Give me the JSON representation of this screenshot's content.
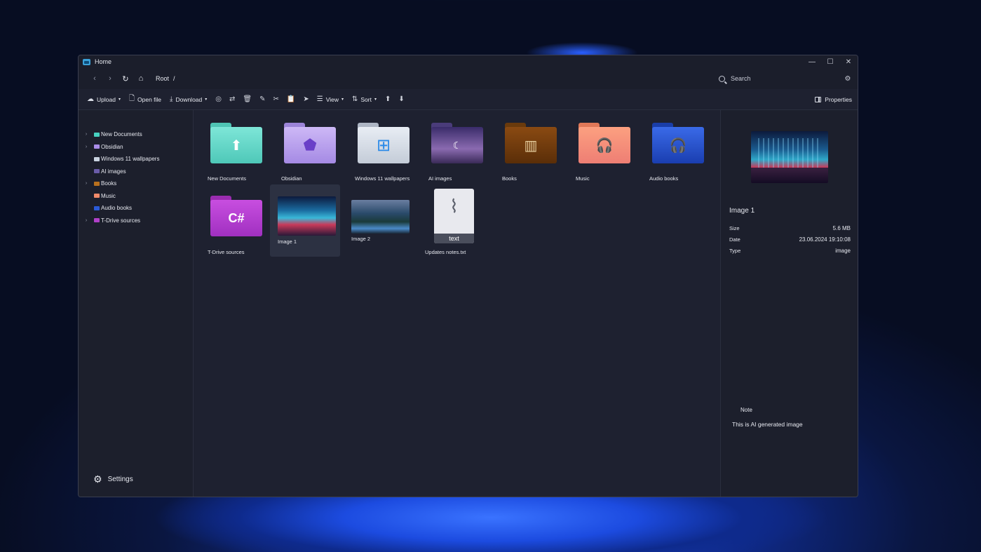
{
  "window": {
    "title": "Home",
    "controls": {
      "minimize": "—",
      "maximize": "☐",
      "close": "✕"
    }
  },
  "address": {
    "back": "‹",
    "forward": "›",
    "refresh": "↻",
    "home": "⌂",
    "breadcrumb": [
      "Root",
      "/"
    ],
    "search_placeholder": "Search",
    "filter_icon": "⚙"
  },
  "toolbar": {
    "upload": "Upload",
    "open_file": "Open file",
    "download": "Download",
    "view": "View",
    "sort": "Sort",
    "properties": "Properties",
    "icons": {
      "upload": "☁",
      "open_file": "🗋",
      "download": "⤓",
      "palette": "◎",
      "move": "⇄",
      "delete": "🗑",
      "rename": "✎",
      "cut": "✂",
      "paste": "📋",
      "send": "➤",
      "view": "☰",
      "sort": "⇅",
      "move_up": "⬆",
      "move_down": "⬇",
      "caret": "▾"
    }
  },
  "sidebar": {
    "items": [
      {
        "label": "New Documents",
        "expandable": true,
        "color": "#47d1c0"
      },
      {
        "label": "Obsidian",
        "expandable": true,
        "color": "#a98ce8"
      },
      {
        "label": "Windows 11 wallpapers",
        "expandable": false,
        "color": "#c9d3e0"
      },
      {
        "label": "AI images",
        "expandable": false,
        "color": "#6a5ca8"
      },
      {
        "label": "Books",
        "expandable": true,
        "color": "#b8701e"
      },
      {
        "label": "Music",
        "expandable": false,
        "color": "#f08a6a"
      },
      {
        "label": "Audio books",
        "expandable": false,
        "color": "#2a5ad8"
      },
      {
        "label": "T-Drive sources",
        "expandable": true,
        "color": "#b040c8"
      }
    ],
    "settings_label": "Settings",
    "chevron": "›",
    "gear": "⚙"
  },
  "grid": {
    "items": [
      {
        "label": "New Documents",
        "kind": "folder",
        "color": "#5fd8c8",
        "glyph": "⬆"
      },
      {
        "label": "Obsidian",
        "kind": "folder",
        "color": "#b9a2ee",
        "glyph": "⬟"
      },
      {
        "label": "Windows 11 wallpapers",
        "kind": "folder",
        "color": "#d3dae4",
        "glyph": "⊞"
      },
      {
        "label": "AI images",
        "kind": "folder",
        "color": "#5a4a90",
        "glyph": "☾"
      },
      {
        "label": "Books",
        "kind": "folder",
        "color": "#9a5a14",
        "glyph": "▥"
      },
      {
        "label": "Music",
        "kind": "folder",
        "color": "#f38e6c",
        "glyph": "🎧"
      },
      {
        "label": "Audio books",
        "kind": "folder",
        "color": "#2250c8",
        "glyph": "🎧"
      },
      {
        "label": "T-Drive sources",
        "kind": "folder",
        "color": "#b440cc",
        "glyph": "C#"
      },
      {
        "label": "Image 1",
        "kind": "image"
      },
      {
        "label": "Image 2",
        "kind": "image"
      },
      {
        "label": "Updates notes.txt",
        "kind": "file",
        "tag": "text"
      }
    ]
  },
  "details": {
    "name": "Image 1",
    "rows": [
      {
        "key": "Size",
        "value": "5.6 MB"
      },
      {
        "key": "Date",
        "value": "23.06.2024 19:10:08"
      },
      {
        "key": "Type",
        "value": "image"
      }
    ],
    "note_label": "Note",
    "note_text": "This is AI generated image"
  }
}
